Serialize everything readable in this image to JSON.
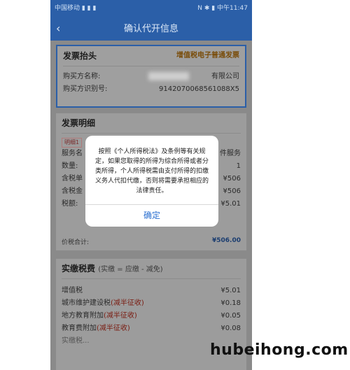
{
  "status_bar": {
    "left": "中国移动 ▮ ▮ ▮",
    "right": "N ✱ ▮ 中午11:47"
  },
  "header": {
    "title": "确认代开信息"
  },
  "invoice_header": {
    "title": "发票抬头",
    "type": "增值税电子普通发票",
    "buyer_name_label": "购买方名称:",
    "buyer_name_value": "有限公司",
    "buyer_id_label": "购买方识别号:",
    "buyer_id_value": "9142070068561088X5"
  },
  "invoice_detail": {
    "title": "发票明细",
    "badge": "明细1",
    "rows": [
      {
        "label": "服务名",
        "value": "件服务"
      },
      {
        "label": "数量:",
        "value": "1"
      },
      {
        "label": "含税单",
        "value": "¥506"
      },
      {
        "label": "含税金",
        "value": "¥506"
      },
      {
        "label": "税额:",
        "value": "¥5.01"
      }
    ],
    "total_label": "价税合计:",
    "total_value": "¥506.00"
  },
  "tax_paid": {
    "title": "实缴税费",
    "subtitle": "(实缴 = 应缴 - 减免)",
    "rows": [
      {
        "label": "增值税",
        "tag": "",
        "value": "¥5.01"
      },
      {
        "label": "城市维护建设税",
        "tag": "(减半征收)",
        "value": "¥0.18"
      },
      {
        "label": "地方教育附加",
        "tag": "(减半征收)",
        "value": "¥0.05"
      },
      {
        "label": "教育费附加",
        "tag": "(减半征收)",
        "value": "¥0.08"
      }
    ],
    "cut_off_label": "实缴税..."
  },
  "dialog": {
    "message": "按照《个人所得税法》及条例等有关规定，如果您取得的所得为综合所得或者分类所得，个人所得税需由支付所得的扣缴义务人代扣代缴，否则将需要承担相应的法律责任。",
    "confirm_label": "确定"
  },
  "watermark": "hubeihong.com"
}
